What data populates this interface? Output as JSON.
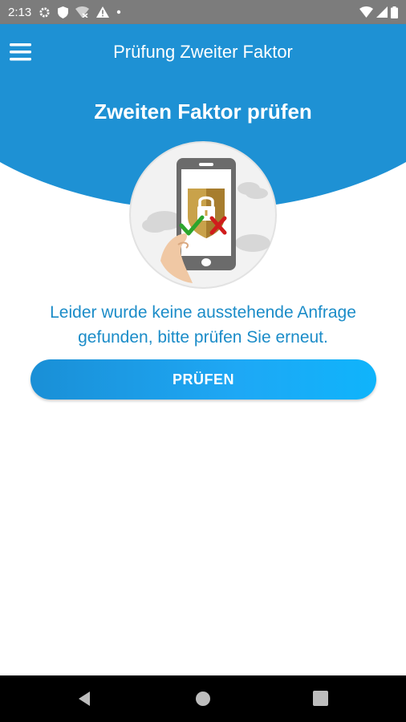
{
  "status_bar": {
    "time": "2:13",
    "left_icons": [
      "settings-icon",
      "shield-icon",
      "wifi-off-icon",
      "warning-icon",
      "dot-icon"
    ],
    "right_icons": [
      "wifi-icon",
      "signal-icon",
      "battery-icon"
    ]
  },
  "app_bar": {
    "title": "Prüfung Zweiter Faktor",
    "menu_icon": "menu-icon",
    "color": "#1e91d4"
  },
  "main": {
    "heading": "Zweiten Faktor prüfen",
    "illustration": "phone-verification-icon",
    "message": "Leider wurde keine ausstehende Anfrage gefunden, bitte prüfen Sie erneut.",
    "check_button_label": "PRÜFEN"
  },
  "nav_bar": {
    "buttons": [
      "back-icon",
      "home-icon",
      "recents-icon"
    ]
  },
  "colors": {
    "accent": "#1e91d4",
    "message_text": "#1b8cc8",
    "success": "#2ca52c",
    "error": "#d01c1c"
  }
}
